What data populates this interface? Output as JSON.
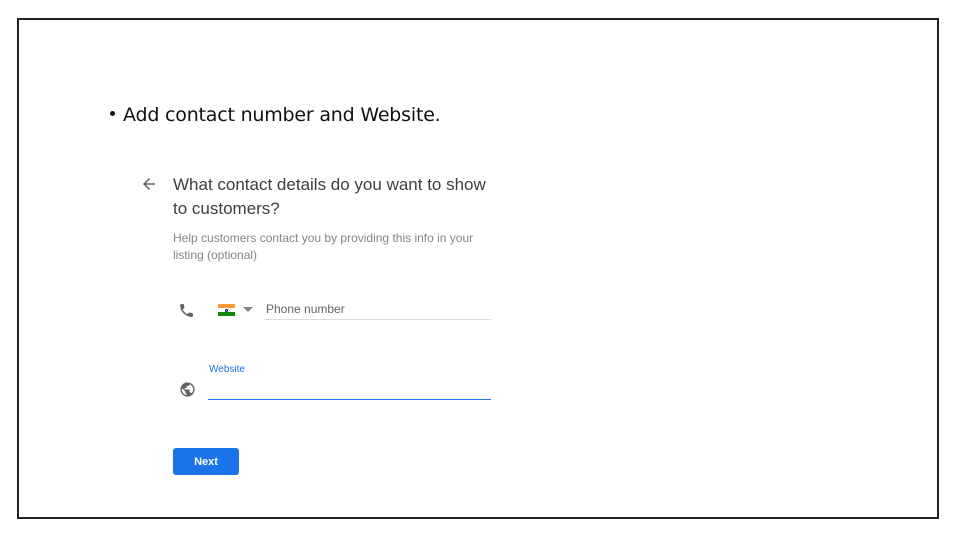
{
  "slide": {
    "bullet_text": "Add contact number and Website."
  },
  "form": {
    "heading": "What contact details do you want to show to customers?",
    "help_text": "Help customers contact you by providing this info in your listing (optional)",
    "phone": {
      "placeholder": "Phone number",
      "value": "",
      "country_icon": "india-flag-icon"
    },
    "website": {
      "label": "Website",
      "value": ""
    },
    "next_label": "Next"
  },
  "colors": {
    "accent": "#1a73e8",
    "text_primary": "#3c4043",
    "text_secondary": "#80868b",
    "divider": "#dadce0"
  },
  "icons": {
    "back": "arrow-left-icon",
    "phone": "phone-icon",
    "website": "globe-icon",
    "dropdown": "caret-down-icon"
  }
}
